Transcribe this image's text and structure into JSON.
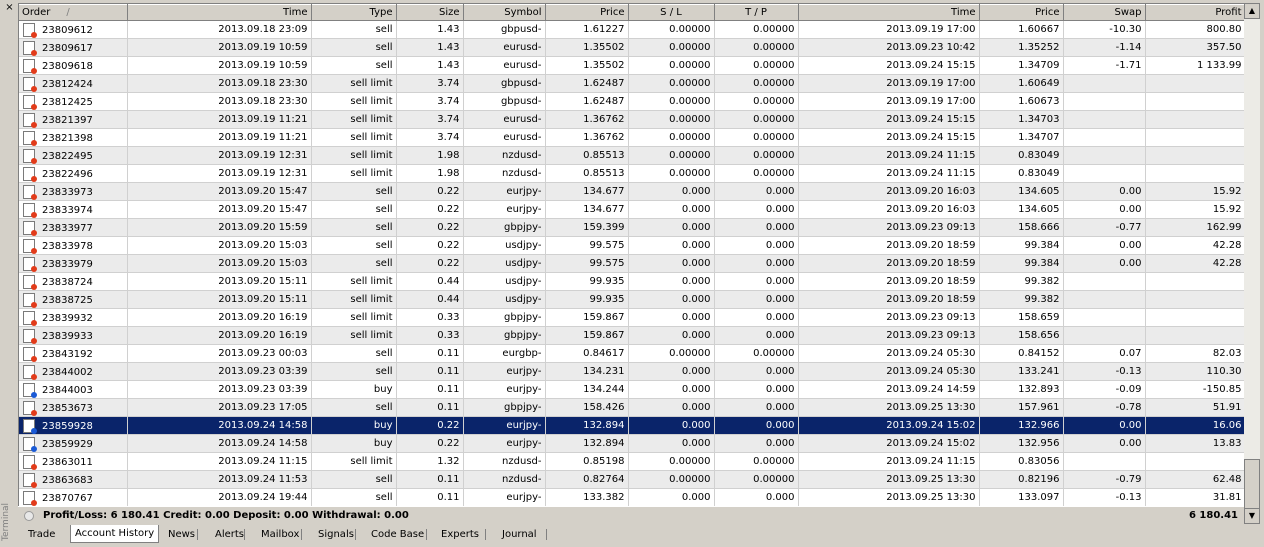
{
  "window": {
    "close_glyph": "×",
    "terminal_label": "Terminal"
  },
  "columns": [
    "Order",
    "Time",
    "Type",
    "Size",
    "Symbol",
    "Price",
    "S / L",
    "T / P",
    "Time",
    "Price",
    "Swap",
    "Profit"
  ],
  "order_sort_glyph": "/",
  "selected_order": "23859928",
  "rows": [
    [
      "23809612",
      "2013.09.18 23:09",
      "sell",
      "1.43",
      "gbpusd-",
      "1.61227",
      "0.00000",
      "0.00000",
      "2013.09.19 17:00",
      "1.60667",
      "-10.30",
      "800.80"
    ],
    [
      "23809617",
      "2013.09.19 10:59",
      "sell",
      "1.43",
      "eurusd-",
      "1.35502",
      "0.00000",
      "0.00000",
      "2013.09.23 10:42",
      "1.35252",
      "-1.14",
      "357.50"
    ],
    [
      "23809618",
      "2013.09.19 10:59",
      "sell",
      "1.43",
      "eurusd-",
      "1.35502",
      "0.00000",
      "0.00000",
      "2013.09.24 15:15",
      "1.34709",
      "-1.71",
      "1 133.99"
    ],
    [
      "23812424",
      "2013.09.18 23:30",
      "sell limit",
      "3.74",
      "gbpusd-",
      "1.62487",
      "0.00000",
      "0.00000",
      "2013.09.19 17:00",
      "1.60649",
      "",
      ""
    ],
    [
      "23812425",
      "2013.09.18 23:30",
      "sell limit",
      "3.74",
      "gbpusd-",
      "1.62487",
      "0.00000",
      "0.00000",
      "2013.09.19 17:00",
      "1.60673",
      "",
      ""
    ],
    [
      "23821397",
      "2013.09.19 11:21",
      "sell limit",
      "3.74",
      "eurusd-",
      "1.36762",
      "0.00000",
      "0.00000",
      "2013.09.24 15:15",
      "1.34703",
      "",
      ""
    ],
    [
      "23821398",
      "2013.09.19 11:21",
      "sell limit",
      "3.74",
      "eurusd-",
      "1.36762",
      "0.00000",
      "0.00000",
      "2013.09.24 15:15",
      "1.34707",
      "",
      ""
    ],
    [
      "23822495",
      "2013.09.19 12:31",
      "sell limit",
      "1.98",
      "nzdusd-",
      "0.85513",
      "0.00000",
      "0.00000",
      "2013.09.24 11:15",
      "0.83049",
      "",
      ""
    ],
    [
      "23822496",
      "2013.09.19 12:31",
      "sell limit",
      "1.98",
      "nzdusd-",
      "0.85513",
      "0.00000",
      "0.00000",
      "2013.09.24 11:15",
      "0.83049",
      "",
      ""
    ],
    [
      "23833973",
      "2013.09.20 15:47",
      "sell",
      "0.22",
      "eurjpy-",
      "134.677",
      "0.000",
      "0.000",
      "2013.09.20 16:03",
      "134.605",
      "0.00",
      "15.92"
    ],
    [
      "23833974",
      "2013.09.20 15:47",
      "sell",
      "0.22",
      "eurjpy-",
      "134.677",
      "0.000",
      "0.000",
      "2013.09.20 16:03",
      "134.605",
      "0.00",
      "15.92"
    ],
    [
      "23833977",
      "2013.09.20 15:59",
      "sell",
      "0.22",
      "gbpjpy-",
      "159.399",
      "0.000",
      "0.000",
      "2013.09.23 09:13",
      "158.666",
      "-0.77",
      "162.99"
    ],
    [
      "23833978",
      "2013.09.20 15:03",
      "sell",
      "0.22",
      "usdjpy-",
      "99.575",
      "0.000",
      "0.000",
      "2013.09.20 18:59",
      "99.384",
      "0.00",
      "42.28"
    ],
    [
      "23833979",
      "2013.09.20 15:03",
      "sell",
      "0.22",
      "usdjpy-",
      "99.575",
      "0.000",
      "0.000",
      "2013.09.20 18:59",
      "99.384",
      "0.00",
      "42.28"
    ],
    [
      "23838724",
      "2013.09.20 15:11",
      "sell limit",
      "0.44",
      "usdjpy-",
      "99.935",
      "0.000",
      "0.000",
      "2013.09.20 18:59",
      "99.382",
      "",
      ""
    ],
    [
      "23838725",
      "2013.09.20 15:11",
      "sell limit",
      "0.44",
      "usdjpy-",
      "99.935",
      "0.000",
      "0.000",
      "2013.09.20 18:59",
      "99.382",
      "",
      ""
    ],
    [
      "23839932",
      "2013.09.20 16:19",
      "sell limit",
      "0.33",
      "gbpjpy-",
      "159.867",
      "0.000",
      "0.000",
      "2013.09.23 09:13",
      "158.659",
      "",
      ""
    ],
    [
      "23839933",
      "2013.09.20 16:19",
      "sell limit",
      "0.33",
      "gbpjpy-",
      "159.867",
      "0.000",
      "0.000",
      "2013.09.23 09:13",
      "158.656",
      "",
      ""
    ],
    [
      "23843192",
      "2013.09.23 00:03",
      "sell",
      "0.11",
      "eurgbp-",
      "0.84617",
      "0.00000",
      "0.00000",
      "2013.09.24 05:30",
      "0.84152",
      "0.07",
      "82.03"
    ],
    [
      "23844002",
      "2013.09.23 03:39",
      "sell",
      "0.11",
      "eurjpy-",
      "134.231",
      "0.000",
      "0.000",
      "2013.09.24 05:30",
      "133.241",
      "-0.13",
      "110.30"
    ],
    [
      "23844003",
      "2013.09.23 03:39",
      "buy",
      "0.11",
      "eurjpy-",
      "134.244",
      "0.000",
      "0.000",
      "2013.09.24 14:59",
      "132.893",
      "-0.09",
      "-150.85"
    ],
    [
      "23853673",
      "2013.09.23 17:05",
      "sell",
      "0.11",
      "gbpjpy-",
      "158.426",
      "0.000",
      "0.000",
      "2013.09.25 13:30",
      "157.961",
      "-0.78",
      "51.91"
    ],
    [
      "23859928",
      "2013.09.24 14:58",
      "buy",
      "0.22",
      "eurjpy-",
      "132.894",
      "0.000",
      "0.000",
      "2013.09.24 15:02",
      "132.966",
      "0.00",
      "16.06"
    ],
    [
      "23859929",
      "2013.09.24 14:58",
      "buy",
      "0.22",
      "eurjpy-",
      "132.894",
      "0.000",
      "0.000",
      "2013.09.24 15:02",
      "132.956",
      "0.00",
      "13.83"
    ],
    [
      "23863011",
      "2013.09.24 11:15",
      "sell limit",
      "1.32",
      "nzdusd-",
      "0.85198",
      "0.00000",
      "0.00000",
      "2013.09.24 11:15",
      "0.83056",
      "",
      ""
    ],
    [
      "23863683",
      "2013.09.24 11:53",
      "sell",
      "0.11",
      "nzdusd-",
      "0.82764",
      "0.00000",
      "0.00000",
      "2013.09.25 13:30",
      "0.82196",
      "-0.79",
      "62.48"
    ],
    [
      "23870767",
      "2013.09.24 19:44",
      "sell",
      "0.11",
      "eurjpy-",
      "133.382",
      "0.000",
      "0.000",
      "2013.09.25 13:30",
      "133.097",
      "-0.13",
      "31.81"
    ]
  ],
  "summary": {
    "text": "Profit/Loss: 6 180.41  Credit: 0.00  Deposit: 0.00  Withdrawal: 0.00",
    "total": "6 180.41"
  },
  "scroll": {
    "up_glyph": "▲",
    "down_glyph": "▼"
  },
  "tabs": [
    "Trade",
    "Account History",
    "News",
    "Alerts",
    "Mailbox",
    "Signals",
    "Code Base",
    "Experts",
    "Journal"
  ],
  "active_tab": "Account History"
}
